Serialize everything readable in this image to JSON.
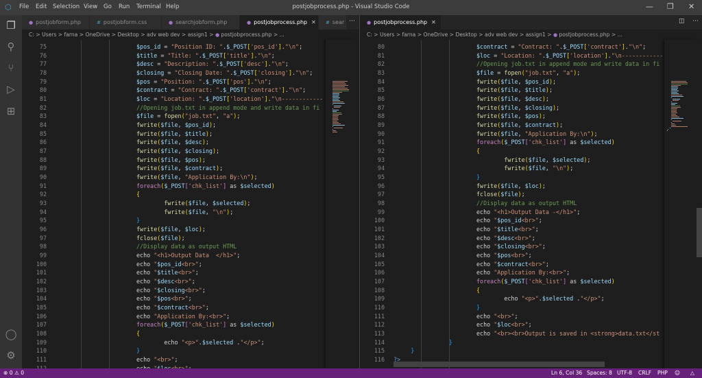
{
  "titlebar": {
    "menu": [
      "File",
      "Edit",
      "Selection",
      "View",
      "Go",
      "Run",
      "Terminal",
      "Help"
    ],
    "title": "postjobprocess.php - Visual Studio Code"
  },
  "activity_bar": [
    "explorer-icon",
    "search-icon",
    "source-control-icon",
    "run-debug-icon",
    "extensions-icon",
    "account-icon",
    "gear-icon"
  ],
  "left_group": {
    "tabs": [
      {
        "label": "postjobform.php",
        "type": "php"
      },
      {
        "label": "postjobform.css",
        "type": "css"
      },
      {
        "label": "searchjobform.php",
        "type": "php"
      },
      {
        "label": "postjobprocess.php",
        "type": "php",
        "active": true
      },
      {
        "label": "sear",
        "type": "css"
      }
    ],
    "breadcrumbs": [
      "C:",
      "Users",
      "farna",
      "OneDrive",
      "Desktop",
      "adv web dev",
      "assign1",
      "postjobprocess.php",
      "..."
    ],
    "first_line": 75,
    "lines": [
      "                        $pos_id = \"Position ID: \".$_POST['pos_id'].\"\\n\";",
      "                        $title = \"Title: \".$_POST['title'].\"\\n\";",
      "                        $desc = \"Description: \".$_POST['desc'].\"\\n\";",
      "                        $closing = \"Closing Date: \".$_POST['closing'].\"\\n\";",
      "                        $pos = \"Position: \".$_POST['pos'].\"\\n\";",
      "                        $contract = \"Contract: \".$_POST['contract'].\"\\n\";",
      "                        $loc = \"Location: \".$_POST['location'].\"\\n------------",
      "                        //Opening job.txt in append mode and write data in fi",
      "                        $file = fopen(\"job.txt\", \"a\");",
      "                        fwrite($file, $pos_id);",
      "                        fwrite($file, $title);",
      "                        fwrite($file, $desc);",
      "                        fwrite($file, $closing);",
      "                        fwrite($file, $pos);",
      "                        fwrite($file, $contract);",
      "                        fwrite($file, \"Application By:\\n\");",
      "                        foreach($_POST['chk_list'] as $selected)",
      "                        {",
      "                                fwrite($file, $selected);",
      "                                fwrite($file, \"\\n\");",
      "                        }",
      "                        fwrite($file, $loc);",
      "                        fclose($file);",
      "                        //Display data as output HTML",
      "                        echo \"<h1>Output Data  </h1>\";",
      "                        echo \"$pos_id<br>\";",
      "                        echo \"$title<br>\";",
      "                        echo \"$desc<br>\";",
      "                        echo \"$closing<br>\";",
      "                        echo \"$pos<br>\";",
      "                        echo \"$contract<br>\";",
      "                        echo \"Application By:<br>\";",
      "                        foreach($_POST['chk_list'] as $selected)",
      "                        {",
      "                                echo \"<p>\".$selected .\"</p>\";",
      "                        }",
      "                        echo \"<br>\";",
      "                        echo \"$loc<br>\";"
    ]
  },
  "right_group": {
    "tabs": [
      {
        "label": "postjobprocess.php",
        "type": "php",
        "active": true
      }
    ],
    "breadcrumbs": [
      "C:",
      "Users",
      "farna",
      "OneDrive",
      "Desktop",
      "adv web dev",
      "assign1",
      "postjobprocess.php",
      "..."
    ],
    "first_line": 80,
    "lines": [
      "                        $contract = \"Contract: \".$_POST['contract'].\"\\n\";",
      "                        $loc = \"Location: \".$_POST['location'].\"\\n------------",
      "                        //Opening job.txt in append mode and write data in fi",
      "                        $file = fopen(\"job.txt\", \"a\");",
      "                        fwrite($file, $pos_id);",
      "                        fwrite($file, $title);",
      "                        fwrite($file, $desc);",
      "                        fwrite($file, $closing);",
      "                        fwrite($file, $pos);",
      "                        fwrite($file, $contract);",
      "                        fwrite($file, \"Application By:\\n\");",
      "                        foreach($_POST['chk_list'] as $selected)",
      "                        {",
      "                                fwrite($file, $selected);",
      "                                fwrite($file, \"\\n\");",
      "                        }",
      "                        fwrite($file, $loc);",
      "                        fclose($file);",
      "                        //Display data as output HTML",
      "                        echo \"<h1>Output Data -</h1>\";",
      "                        echo \"$pos_id<br>\";",
      "                        echo \"$title<br>\";",
      "                        echo \"$desc<br>\";",
      "                        echo \"$closing<br>\";",
      "                        echo \"$pos<br>\";",
      "                        echo \"$contract<br>\";",
      "                        echo \"Application By:<br>\";",
      "                        foreach($_POST['chk_list'] as $selected)",
      "                        {",
      "                                echo \"<p>\".$selected .\"</p>\";",
      "                        }",
      "                        echo \"<br>\";",
      "                        echo \"$loc<br>\";",
      "                        echo \"<br><br>Output is saved in <strong>data.txt</st",
      "                }",
      "     }",
      "?>"
    ]
  },
  "status": {
    "errors": "0",
    "warnings": "0",
    "position": "Ln 6, Col 36",
    "spaces": "Spaces: 8",
    "encoding": "UTF-8",
    "eol": "CRLF",
    "language": "PHP"
  },
  "colors": {
    "status_bar": "#68217a",
    "editor_bg": "#1e1e1e",
    "accent": "#007acc"
  }
}
